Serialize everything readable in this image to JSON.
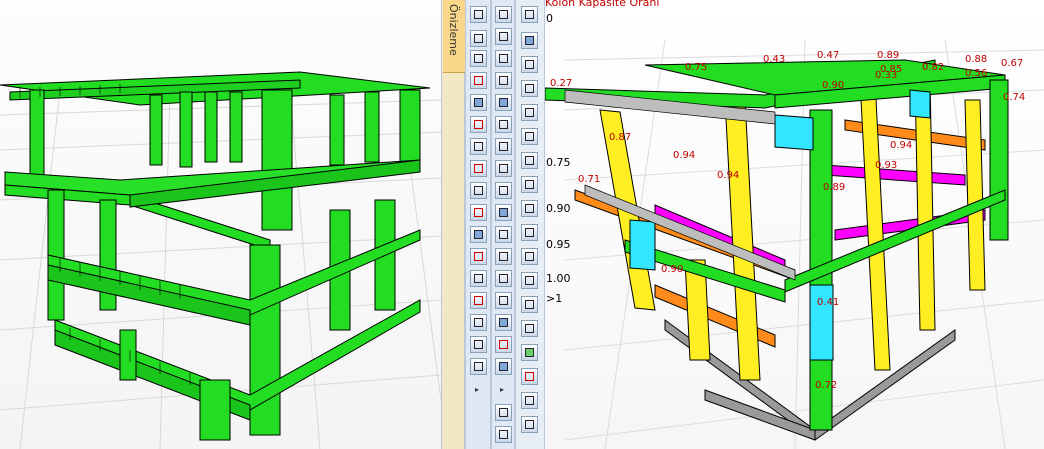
{
  "panel_tab": {
    "label": "Önizleme"
  },
  "chart_title": "Kolon Kapasite Oranı",
  "ratio_legend": {
    "values": [
      "0",
      "0.75",
      "0.90",
      "0.95",
      "1.00",
      ">1"
    ],
    "colors": [
      "#2de02d",
      "#ffff33",
      "#ff8c1a",
      "#ff00ff",
      "#33e6ff",
      "#ff3b00"
    ]
  },
  "element_labels": [
    "0.27",
    "0.75",
    "0.43",
    "0.47",
    "0.89",
    "0.88",
    "0.67",
    "0.85",
    "0.90",
    "0.33",
    "0.82",
    "0.56",
    "0.74",
    "0.87",
    "0.94",
    "0.94",
    "0.93",
    "0.94",
    "0.71",
    "0.89",
    "0.90",
    "0.41",
    "0.72"
  ],
  "colors": {
    "frame_green": "#22dd22",
    "frame_yellow": "#ffee22",
    "frame_orange": "#ff8c1a",
    "frame_magenta": "#ff00ff",
    "frame_cyan": "#33e6ff",
    "foundation_gray": "#9a9a9a",
    "toolbar_bg": "#dfe8f3",
    "tab_bg": "#f8d78a"
  }
}
